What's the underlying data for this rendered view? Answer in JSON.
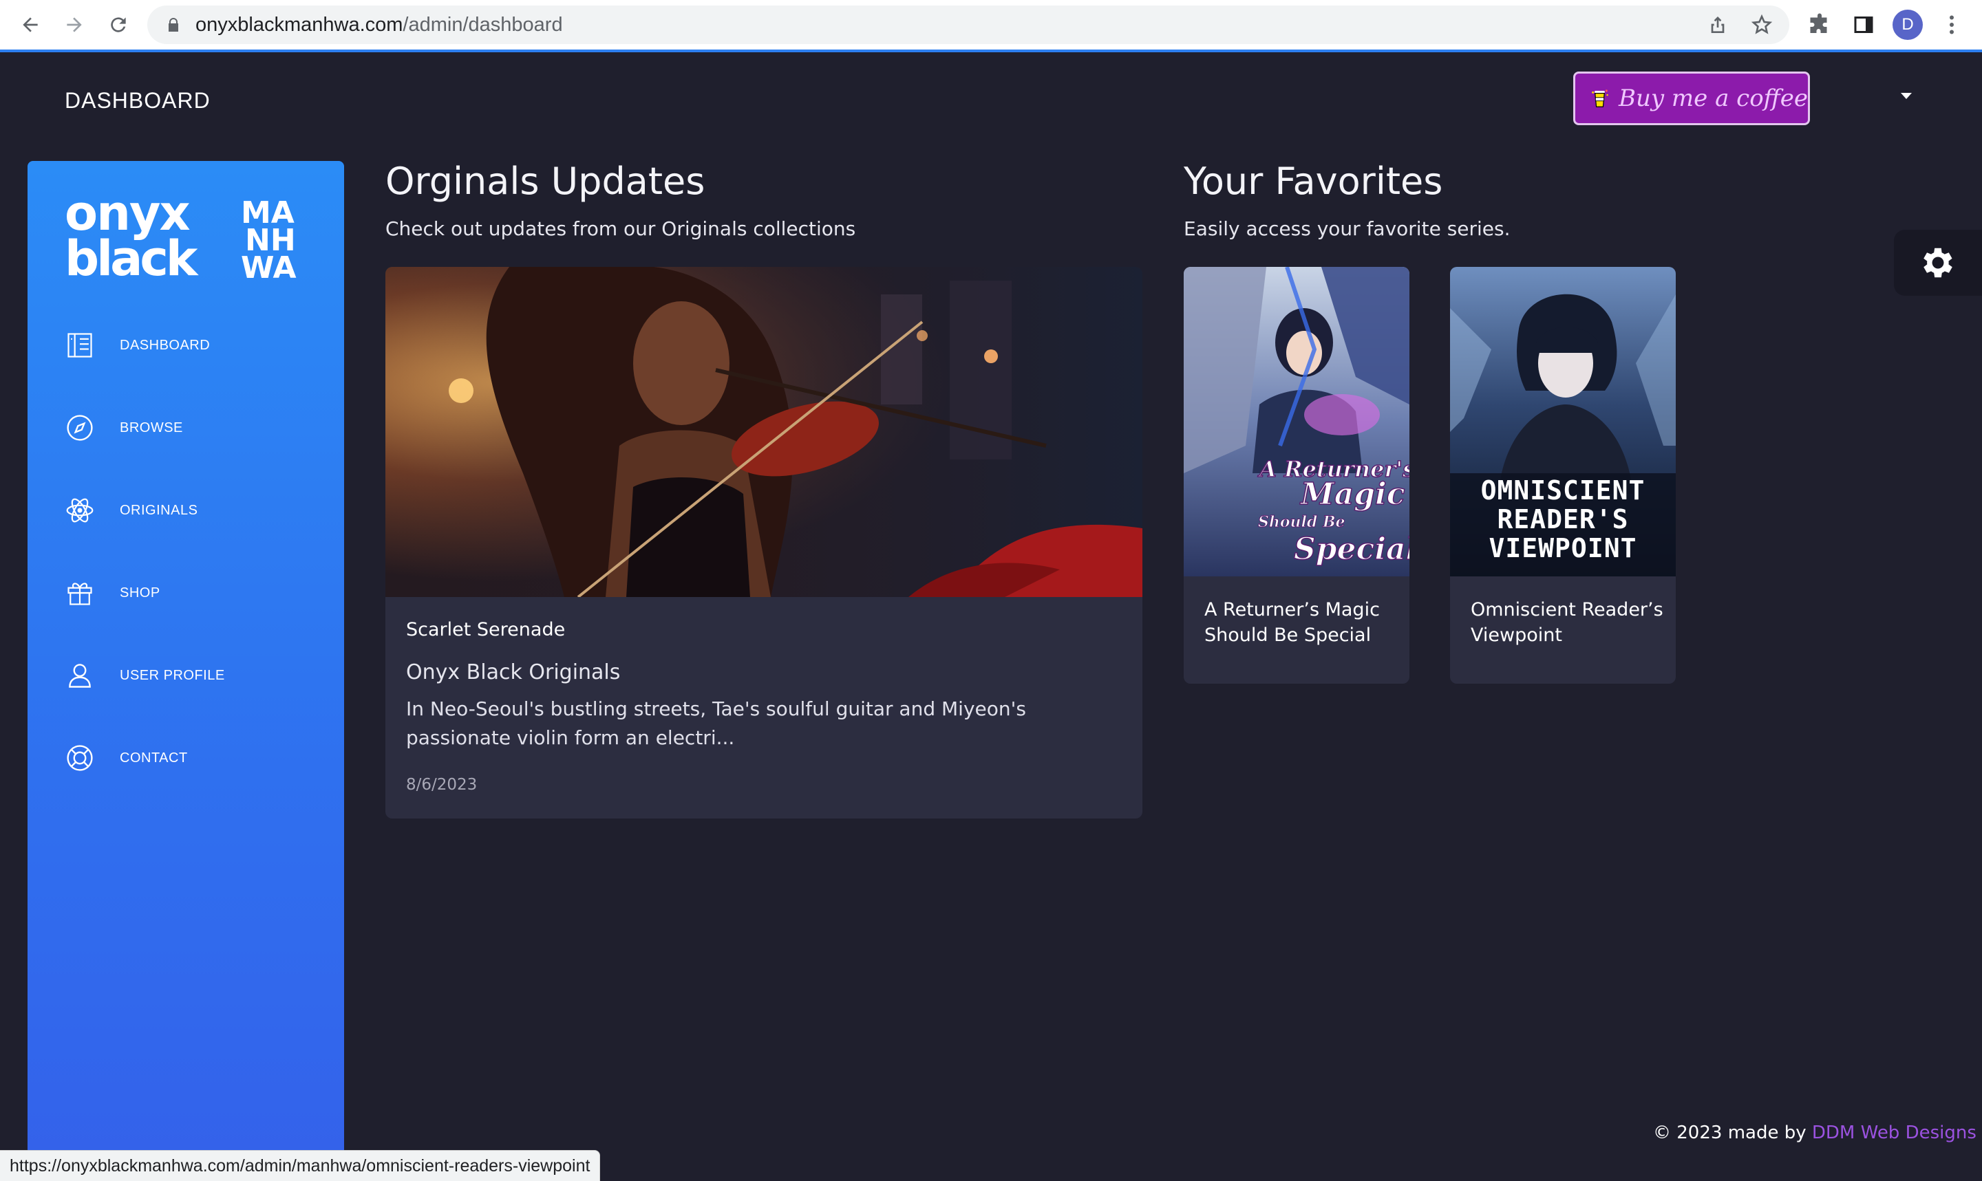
{
  "browser": {
    "url_host": "onyxblackmanhwa.com",
    "url_path": "/admin/dashboard",
    "profile_initial": "D",
    "status_url": "https://onyxblackmanhwa.com/admin/manhwa/omniscient-readers-viewpoint"
  },
  "header": {
    "title": "DASHBOARD",
    "coffee_label": "Buy me a coffee"
  },
  "sidebar": {
    "logo": "onyx black MANHWA",
    "items": [
      {
        "label": "DASHBOARD",
        "icon": "dashboard-icon"
      },
      {
        "label": "BROWSE",
        "icon": "compass-icon"
      },
      {
        "label": "ORIGINALS",
        "icon": "atom-icon"
      },
      {
        "label": "SHOP",
        "icon": "gift-icon"
      },
      {
        "label": "USER PROFILE",
        "icon": "user-icon"
      },
      {
        "label": "CONTACT",
        "icon": "lifebuoy-icon"
      }
    ]
  },
  "originals": {
    "title": "Orginals Updates",
    "subtitle": "Check out updates from our Originals collections",
    "card": {
      "name": "Scarlet Serenade",
      "collection": "Onyx Black Originals",
      "description": "In Neo-Seoul's bustling streets, Tae's soulful guitar and Miyeon's passionate violin form an electri...",
      "date": "8/6/2023"
    }
  },
  "favorites": {
    "title": "Your Favorites",
    "subtitle": "Easily access your favorite series.",
    "items": [
      {
        "title": "A Returner’s Magic Should Be Special",
        "cover_text": [
          "A Returner's",
          "Magic",
          "Should Be",
          "Special"
        ]
      },
      {
        "title": "Omniscient Reader’s Viewpoint",
        "cover_text": [
          "OMNISCIENT",
          "READER'S",
          "VIEWPOINT"
        ]
      }
    ]
  },
  "footer": {
    "prefix": "© 2023 made by",
    "link": "DDM Web Designs"
  },
  "colors": {
    "background": "#1f1f2d",
    "card": "#2c2d40",
    "sidebar_top": "#2b8cf6",
    "sidebar_bottom": "#3461ea",
    "coffee_bg": "#8c1bab",
    "footer_link": "#9b52e0"
  }
}
